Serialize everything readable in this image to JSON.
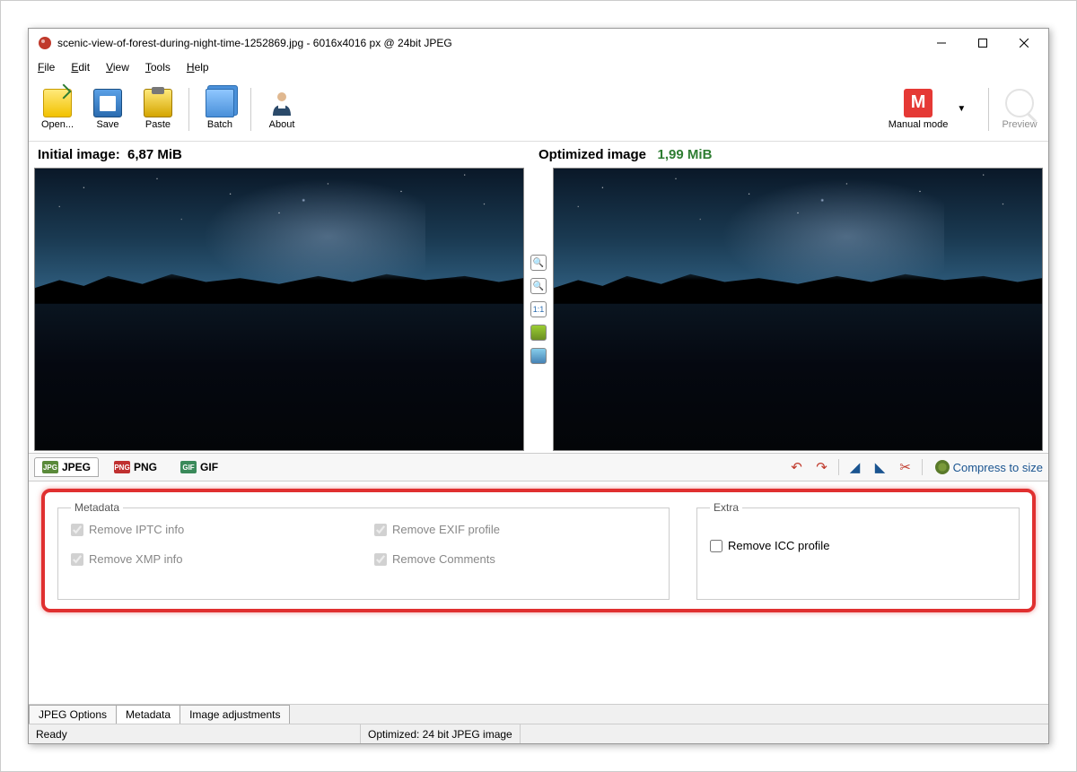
{
  "titlebar": {
    "title": "scenic-view-of-forest-during-night-time-1252869.jpg - 6016x4016 px @ 24bit JPEG"
  },
  "menubar": {
    "file": "File",
    "edit": "Edit",
    "view": "View",
    "tools": "Tools",
    "help": "Help"
  },
  "toolbar": {
    "open": "Open...",
    "save": "Save",
    "paste": "Paste",
    "batch": "Batch",
    "about": "About",
    "mode": "Manual mode",
    "mode_letter": "M",
    "preview": "Preview"
  },
  "sizes": {
    "initial_label": "Initial image:",
    "initial_value": "6,87 MiB",
    "optimized_label": "Optimized image",
    "optimized_value": "1,99 MiB"
  },
  "mid_controls": {
    "ratio": "1:1"
  },
  "format_tabs": {
    "jpeg": "JPEG",
    "png": "PNG",
    "gif": "GIF",
    "compress": "Compress to size"
  },
  "options": {
    "metadata_legend": "Metadata",
    "remove_iptc": "Remove IPTC info",
    "remove_exif": "Remove EXIF profile",
    "remove_xmp": "Remove XMP info",
    "remove_comments": "Remove Comments",
    "extra_legend": "Extra",
    "remove_icc": "Remove ICC profile"
  },
  "bottom_tabs": {
    "jpeg_options": "JPEG Options",
    "metadata": "Metadata",
    "image_adjust": "Image adjustments"
  },
  "statusbar": {
    "ready": "Ready",
    "optimized": "Optimized: 24 bit JPEG image"
  }
}
